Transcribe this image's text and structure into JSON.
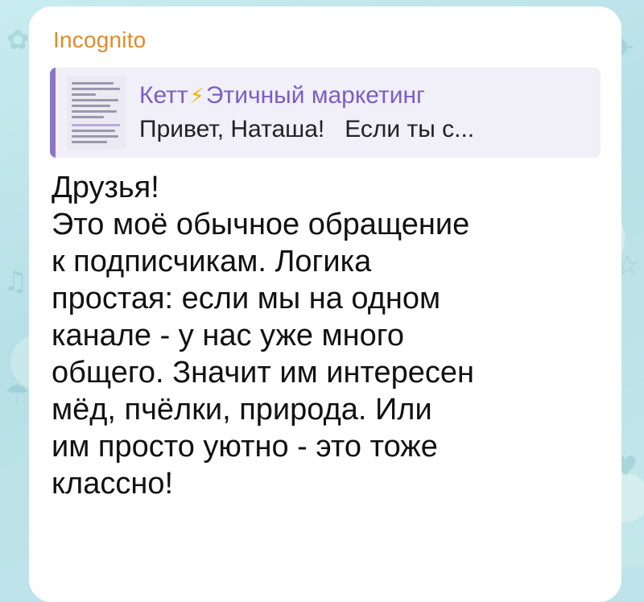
{
  "sender": {
    "name": "Incognito",
    "color": "#e08a2a"
  },
  "reply": {
    "title_part1": "Кетт",
    "title_icon": "lightning-icon",
    "title_part2": "Этичный маркетинг",
    "preview": "Привет, Наташа!   Если ты с...",
    "accent_color": "#8d74c9"
  },
  "message": {
    "lines": [
      "Друзья!",
      "Это моё обычное обращение",
      "к подписчикам. Логика",
      "простая: если мы на одном",
      "канале - у нас уже много",
      "общего. Значит им интересен",
      "мёд, пчёлки, природа. Или",
      "им просто уютно - это тоже",
      "классно!"
    ]
  }
}
